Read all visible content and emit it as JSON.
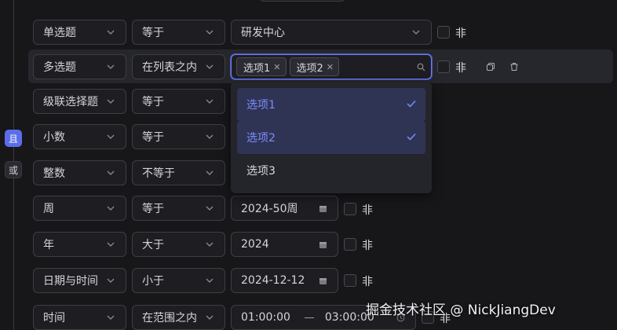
{
  "logic": {
    "and": "且",
    "or": "或"
  },
  "not_label": "非",
  "rows": [
    {
      "field": "单选题",
      "operator": "等于",
      "value": "研发中心"
    },
    {
      "field": "多选题",
      "operator": "在列表之内",
      "tags": [
        "选项1",
        "选项2"
      ]
    },
    {
      "field": "级联选择题",
      "operator": "等于"
    },
    {
      "field": "小数",
      "operator": "等于"
    },
    {
      "field": "整数",
      "operator": "不等于"
    },
    {
      "field": "周",
      "operator": "等于",
      "value": "2024-50周"
    },
    {
      "field": "年",
      "operator": "大于",
      "value": "2024"
    },
    {
      "field": "日期与时间",
      "operator": "小于",
      "value": "2024-12-12"
    },
    {
      "field": "时间",
      "operator": "在范围之内",
      "value_start": "01:00:00",
      "value_end": "03:00:00"
    }
  ],
  "dropdown": {
    "options": [
      {
        "label": "选项1",
        "selected": true
      },
      {
        "label": "选项2",
        "selected": true
      },
      {
        "label": "选项3",
        "selected": false
      }
    ]
  },
  "watermark": "掘金技术社区 @ NickJiangDev",
  "colors": {
    "accent": "#6a7cf0",
    "background": "#17171a",
    "selected_bg": "#2f3454"
  }
}
